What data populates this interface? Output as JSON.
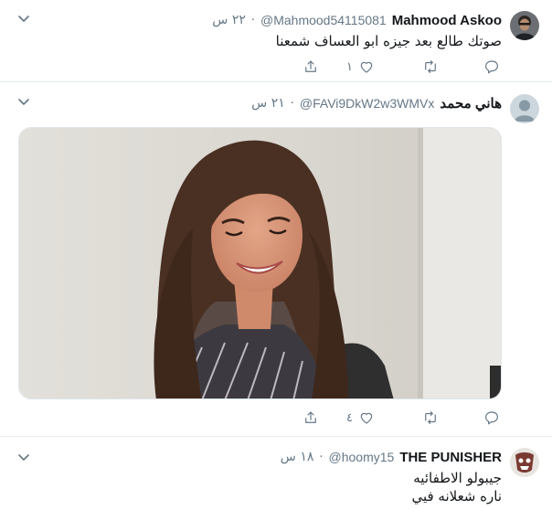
{
  "tweets": [
    {
      "name": "Mahmood Askoo",
      "handle": "@Mahmood54115081",
      "separator": "·",
      "time": "٢٢ س",
      "text": [
        "صوتك طالع بعد جيزه ابو العساف شمعنا"
      ],
      "likes": "١",
      "replies": "",
      "retweets": ""
    },
    {
      "name": "هاني محمد",
      "handle": "@FAVi9DkW2w3WMVx",
      "separator": "·",
      "time": "٢١ س",
      "text": [],
      "likes": "٤",
      "replies": "",
      "retweets": "",
      "media": "photo"
    },
    {
      "name": "THE PUNISHER",
      "handle": "@hoomy15",
      "separator": "·",
      "time": "١٨ س",
      "text": [
        "جيبولو الاطفائيه",
        "ناره شعلانه فيي"
      ]
    }
  ],
  "colors": {
    "secondary_text": "#657786",
    "divider": "#e6ecf0",
    "primary_text": "#14171a"
  },
  "icons": {
    "reply": "reply-icon",
    "retweet": "retweet-icon",
    "like": "heart-icon",
    "share": "share-icon",
    "menu": "chevron-down-icon"
  }
}
